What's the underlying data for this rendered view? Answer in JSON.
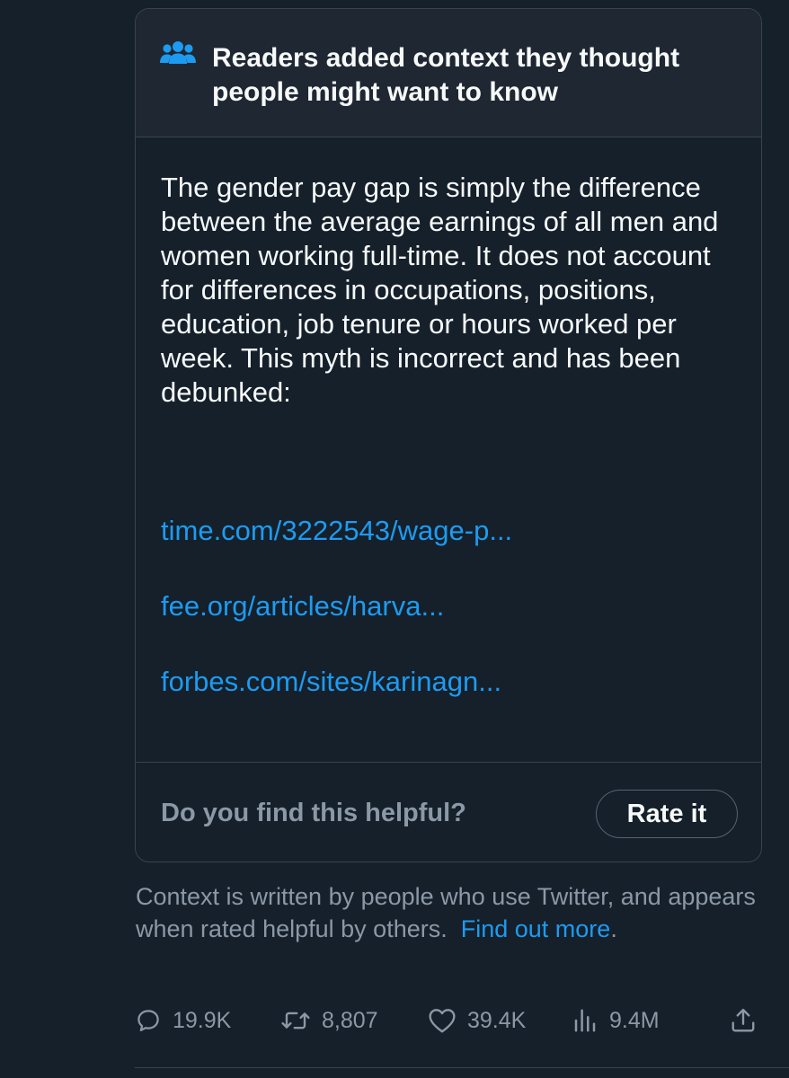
{
  "note": {
    "title": "Readers added context they thought people might want to know",
    "body": "The gender pay gap is simply the difference between the average earnings of all men and women working full-time. It does not account for differences in occupations, positions, education, job tenure or hours worked per week. This myth is incorrect and has been debunked:",
    "links": [
      "time.com/3222543/wage-p...",
      "fee.org/articles/harva...",
      "forbes.com/sites/karinagn..."
    ],
    "helpful_question": "Do you find this helpful?",
    "rate_label": "Rate it"
  },
  "disclaimer": {
    "text": "Context is written by people who use Twitter, and appears when rated helpful by others.",
    "link": "Find out more",
    "trailing": "."
  },
  "actions": {
    "replies": "19.9K",
    "retweets": "8,807",
    "likes": "39.4K",
    "views": "9.4M"
  },
  "colors": {
    "background": "#15202b",
    "header_bg": "#1e2732",
    "border": "#38444d",
    "accent": "#1d9bf0",
    "secondary_text": "#8b98a5",
    "primary_text": "#f7f9f9"
  },
  "icons": {
    "header": "people-icon",
    "reply": "reply-icon",
    "retweet": "retweet-icon",
    "like": "heart-icon",
    "views": "views-icon",
    "share": "share-icon"
  }
}
